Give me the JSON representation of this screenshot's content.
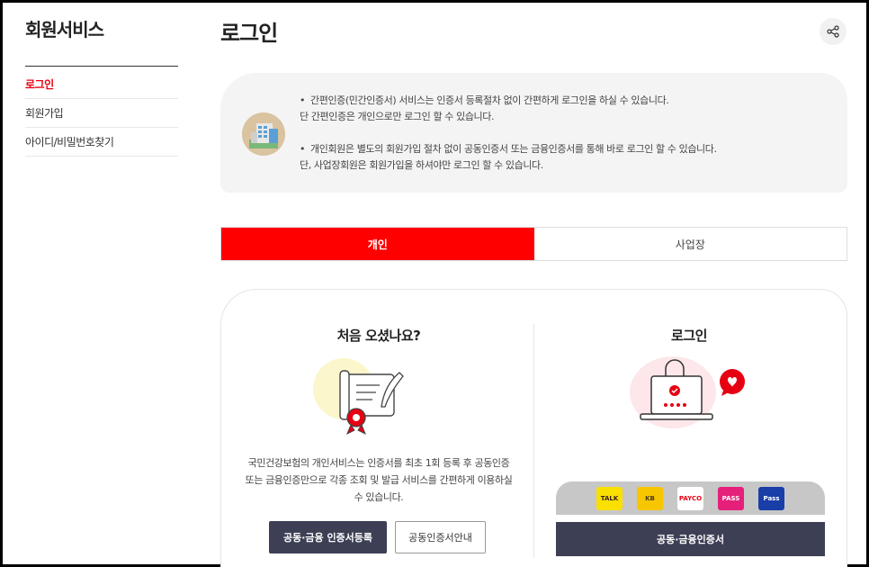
{
  "sidebar": {
    "title": "회원서비스",
    "items": [
      {
        "label": "로그인",
        "active": true
      },
      {
        "label": "회원가입",
        "active": false
      },
      {
        "label": "아이디/비밀번호찾기",
        "active": false
      }
    ]
  },
  "page": {
    "title": "로그인",
    "share_icon": "share-icon"
  },
  "notice": {
    "icon": "building-icon",
    "line1": "간편인증(민간인증서) 서비스는 인증서 등록절차 없이 간편하게 로그인을 하실 수 있습니다.",
    "line2": "단 간편인증은 개인으로만 로그인 할 수 있습니다.",
    "line3": "개인회원은 별도의 회원가입 절차 없이 공동인증서 또는 금융인증서를 통해 바로 로그인 할 수 있습니다.",
    "line4": "단, 사업장회원은 회원가입을 하셔야만 로그인 할 수 있습니다."
  },
  "tabs": [
    {
      "label": "개인",
      "active": true
    },
    {
      "label": "사업장",
      "active": false
    }
  ],
  "left": {
    "title": "처음 오셨나요?",
    "desc1": "국민건강보험의 개인서비스는 인증서를 최초 1회 등록 후 공동인증",
    "desc2": "또는 금융인증만으로 각종 조회 및 발급 서비스를 간편하게 이용하실",
    "desc3": "수 있습니다.",
    "register_button": "공동·금융 인증서등록",
    "guide_button": "공동인증서안내"
  },
  "right": {
    "title": "로그인",
    "providers": [
      {
        "name": "TALK",
        "bg": "#f9e000",
        "fg": "#3b1e1e"
      },
      {
        "name": "KB",
        "bg": "#f7c600",
        "fg": "#4a3b1f"
      },
      {
        "name": "PAYCO",
        "bg": "#ffffff",
        "fg": "#e60012"
      },
      {
        "name": "PASS",
        "bg": "#e5207a",
        "fg": "#ffffff"
      },
      {
        "name": "Pass",
        "bg": "#1a3ea8",
        "fg": "#ffffff"
      }
    ],
    "cert_button": "공동·금융인증서"
  },
  "colors": {
    "accent": "#ff0000",
    "dark_button": "#3d3f55"
  }
}
